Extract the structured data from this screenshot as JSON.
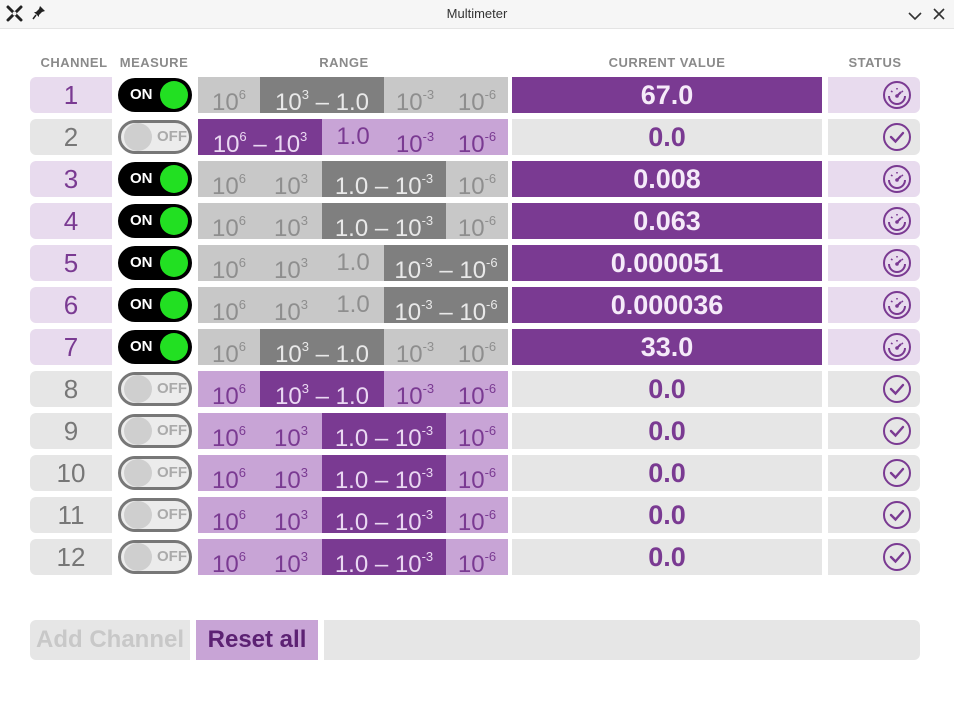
{
  "window": {
    "title": "Multimeter"
  },
  "headers": {
    "channel": "CHANNEL",
    "measure": "MEASURE",
    "range": "RANGE",
    "current_value": "CURRENT VALUE",
    "status": "STATUS"
  },
  "toggle_labels": {
    "on": "ON",
    "off": "OFF"
  },
  "colors": {
    "accent": "#7a3a92",
    "accent_light": "#c8a4d6",
    "on_knob": "#22e022"
  },
  "channels": [
    {
      "channel": "1",
      "on": true,
      "value": "67.0",
      "status": "measuring",
      "segs": [
        {
          "label": "10",
          "exp": "6",
          "sel": false,
          "mid": ""
        },
        {
          "label": "10",
          "exp": "3",
          "sel": true,
          "mid": " – 1.0"
        },
        {
          "label": "10",
          "exp": "-3",
          "sel": false,
          "mid": ""
        },
        {
          "label": "10",
          "exp": "-6",
          "sel": false,
          "mid": ""
        }
      ]
    },
    {
      "channel": "2",
      "on": false,
      "value": "0.0",
      "status": "ok",
      "segs": [
        {
          "label": "10",
          "exp": "6",
          "sel": true,
          "mid": " – 10",
          "exp2": "3"
        },
        {
          "label": "1.0",
          "exp": "",
          "sel": false,
          "mid": ""
        },
        {
          "label": "10",
          "exp": "-3",
          "sel": false,
          "mid": ""
        },
        {
          "label": "10",
          "exp": "-6",
          "sel": false,
          "mid": ""
        }
      ]
    },
    {
      "channel": "3",
      "on": true,
      "value": "0.008",
      "status": "measuring",
      "segs": [
        {
          "label": "10",
          "exp": "6",
          "sel": false,
          "mid": ""
        },
        {
          "label": "10",
          "exp": "3",
          "sel": false,
          "mid": ""
        },
        {
          "label": "1.0",
          "exp": "",
          "sel": true,
          "mid": " – 10",
          "exp2": "-3"
        },
        {
          "label": "10",
          "exp": "-6",
          "sel": false,
          "mid": ""
        }
      ]
    },
    {
      "channel": "4",
      "on": true,
      "value": "0.063",
      "status": "measuring",
      "segs": [
        {
          "label": "10",
          "exp": "6",
          "sel": false,
          "mid": ""
        },
        {
          "label": "10",
          "exp": "3",
          "sel": false,
          "mid": ""
        },
        {
          "label": "1.0",
          "exp": "",
          "sel": true,
          "mid": " – 10",
          "exp2": "-3"
        },
        {
          "label": "10",
          "exp": "-6",
          "sel": false,
          "mid": ""
        }
      ]
    },
    {
      "channel": "5",
      "on": true,
      "value": "0.000051",
      "status": "measuring",
      "segs": [
        {
          "label": "10",
          "exp": "6",
          "sel": false,
          "mid": ""
        },
        {
          "label": "10",
          "exp": "3",
          "sel": false,
          "mid": ""
        },
        {
          "label": "1.0",
          "exp": "",
          "sel": false,
          "mid": ""
        },
        {
          "label": "10",
          "exp": "-3",
          "sel": true,
          "mid": " – 10",
          "exp2": "-6"
        }
      ]
    },
    {
      "channel": "6",
      "on": true,
      "value": "0.000036",
      "status": "measuring",
      "segs": [
        {
          "label": "10",
          "exp": "6",
          "sel": false,
          "mid": ""
        },
        {
          "label": "10",
          "exp": "3",
          "sel": false,
          "mid": ""
        },
        {
          "label": "1.0",
          "exp": "",
          "sel": false,
          "mid": ""
        },
        {
          "label": "10",
          "exp": "-3",
          "sel": true,
          "mid": " – 10",
          "exp2": "-6"
        }
      ]
    },
    {
      "channel": "7",
      "on": true,
      "value": "33.0",
      "status": "measuring",
      "segs": [
        {
          "label": "10",
          "exp": "6",
          "sel": false,
          "mid": ""
        },
        {
          "label": "10",
          "exp": "3",
          "sel": true,
          "mid": " – 1.0"
        },
        {
          "label": "10",
          "exp": "-3",
          "sel": false,
          "mid": ""
        },
        {
          "label": "10",
          "exp": "-6",
          "sel": false,
          "mid": ""
        }
      ]
    },
    {
      "channel": "8",
      "on": false,
      "value": "0.0",
      "status": "ok",
      "segs": [
        {
          "label": "10",
          "exp": "6",
          "sel": false,
          "mid": ""
        },
        {
          "label": "10",
          "exp": "3",
          "sel": true,
          "mid": " – 1.0"
        },
        {
          "label": "10",
          "exp": "-3",
          "sel": false,
          "mid": ""
        },
        {
          "label": "10",
          "exp": "-6",
          "sel": false,
          "mid": ""
        }
      ]
    },
    {
      "channel": "9",
      "on": false,
      "value": "0.0",
      "status": "ok",
      "segs": [
        {
          "label": "10",
          "exp": "6",
          "sel": false,
          "mid": ""
        },
        {
          "label": "10",
          "exp": "3",
          "sel": false,
          "mid": ""
        },
        {
          "label": "1.0",
          "exp": "",
          "sel": true,
          "mid": " – 10",
          "exp2": "-3"
        },
        {
          "label": "10",
          "exp": "-6",
          "sel": false,
          "mid": ""
        }
      ]
    },
    {
      "channel": "10",
      "on": false,
      "value": "0.0",
      "status": "ok",
      "segs": [
        {
          "label": "10",
          "exp": "6",
          "sel": false,
          "mid": ""
        },
        {
          "label": "10",
          "exp": "3",
          "sel": false,
          "mid": ""
        },
        {
          "label": "1.0",
          "exp": "",
          "sel": true,
          "mid": " – 10",
          "exp2": "-3"
        },
        {
          "label": "10",
          "exp": "-6",
          "sel": false,
          "mid": ""
        }
      ]
    },
    {
      "channel": "11",
      "on": false,
      "value": "0.0",
      "status": "ok",
      "segs": [
        {
          "label": "10",
          "exp": "6",
          "sel": false,
          "mid": ""
        },
        {
          "label": "10",
          "exp": "3",
          "sel": false,
          "mid": ""
        },
        {
          "label": "1.0",
          "exp": "",
          "sel": true,
          "mid": " – 10",
          "exp2": "-3"
        },
        {
          "label": "10",
          "exp": "-6",
          "sel": false,
          "mid": ""
        }
      ]
    },
    {
      "channel": "12",
      "on": false,
      "value": "0.0",
      "status": "ok",
      "segs": [
        {
          "label": "10",
          "exp": "6",
          "sel": false,
          "mid": ""
        },
        {
          "label": "10",
          "exp": "3",
          "sel": false,
          "mid": ""
        },
        {
          "label": "1.0",
          "exp": "",
          "sel": true,
          "mid": " – 10",
          "exp2": "-3"
        },
        {
          "label": "10",
          "exp": "-6",
          "sel": false,
          "mid": ""
        }
      ]
    }
  ],
  "footer": {
    "add_channel": "Add Channel",
    "reset_all": "Reset all",
    "message": ""
  }
}
